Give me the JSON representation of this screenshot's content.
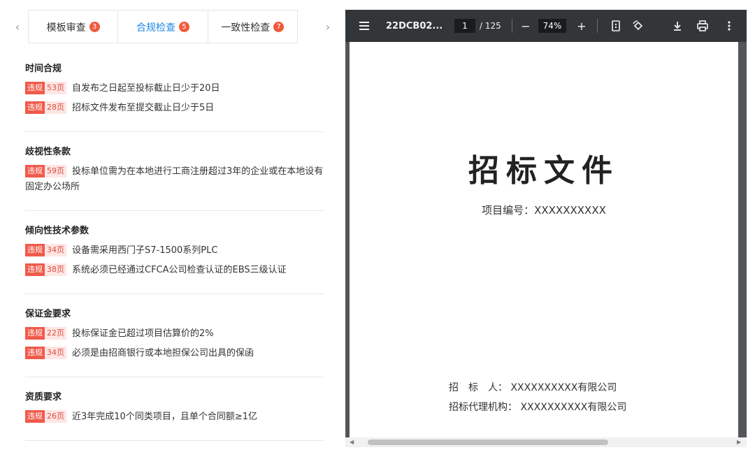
{
  "tabs": [
    {
      "label": "模板审查",
      "count": "3"
    },
    {
      "label": "合规检查",
      "count": "5"
    },
    {
      "label": "一致性检查",
      "count": "7"
    }
  ],
  "colors": {
    "accent": "#1e88e5",
    "violation": "#f05a4a",
    "badge": "#f05a3c"
  },
  "sections": [
    {
      "title": "时间合规",
      "items": [
        {
          "tag": "违规",
          "page": "53页",
          "text": "自发布之日起至投标截止日少于20日"
        },
        {
          "tag": "违规",
          "page": "28页",
          "text": "招标文件发布至提交截止日少于5日"
        }
      ]
    },
    {
      "title": "歧视性条款",
      "items": [
        {
          "tag": "违规",
          "page": "59页",
          "text": "投标单位需为在本地进行工商注册超过3年的企业或在本地设有固定办公场所"
        }
      ]
    },
    {
      "title": "倾向性技术参数",
      "items": [
        {
          "tag": "违规",
          "page": "34页",
          "text": "设备需采用西门子S7-1500系列PLC"
        },
        {
          "tag": "违规",
          "page": "38页",
          "text": "系统必须已经通过CFCA公司检查认证的EBS三级认证"
        }
      ]
    },
    {
      "title": "保证金要求",
      "items": [
        {
          "tag": "违规",
          "page": "22页",
          "text": "投标保证金已超过项目估算价的2%"
        },
        {
          "tag": "违规",
          "page": "34页",
          "text": "必须是由招商银行或本地担保公司出具的保函"
        }
      ]
    },
    {
      "title": "资质要求",
      "items": [
        {
          "tag": "违规",
          "page": "26页",
          "text": "近3年完成10个同类项目，且单个合同额≥1亿"
        }
      ]
    }
  ],
  "viewer": {
    "doc_name": "22DCB02...",
    "current_page": "1",
    "total_pages": "/ 125",
    "zoom": "74%",
    "page_content": {
      "heading": "招标文件",
      "project_number": "项目编号：XXXXXXXXXX",
      "tenderer": "招　标　人：  XXXXXXXXXX有限公司",
      "agency": "招标代理机构：  XXXXXXXXXX有限公司"
    }
  }
}
